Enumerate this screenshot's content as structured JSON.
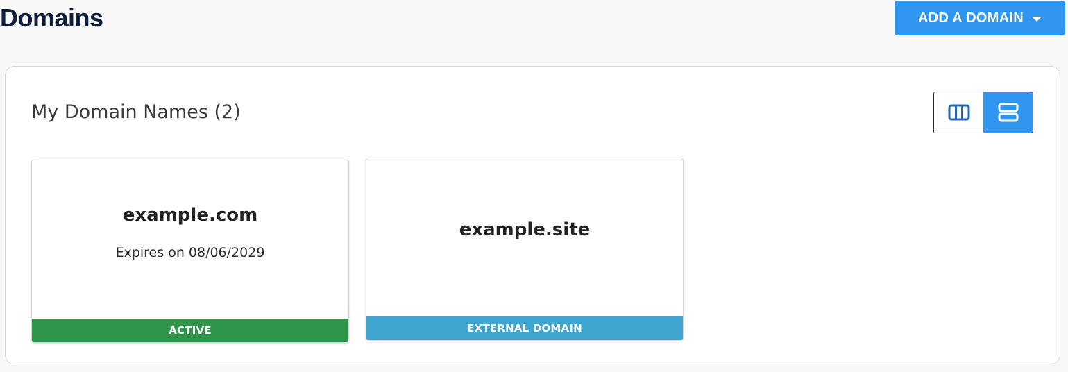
{
  "header": {
    "title": "Domains",
    "add_button_label": "ADD A DOMAIN",
    "add_button_icon": "caret-down-icon"
  },
  "panel": {
    "title": "My Domain Names (2)",
    "view_toggle": {
      "options": [
        {
          "name": "columns-view",
          "icon": "columns-icon",
          "active": false
        },
        {
          "name": "rows-view",
          "icon": "rows-icon",
          "active": true
        }
      ]
    },
    "domains": [
      {
        "name": "example.com",
        "expiry": "Expires on 08/06/2029",
        "status": "ACTIVE",
        "status_color": "#2e954b"
      },
      {
        "name": "example.site",
        "status": "EXTERNAL DOMAIN",
        "status_color": "#3ea6d0"
      }
    ]
  },
  "colors": {
    "accent": "#2f96ef",
    "title": "#0f1f3a",
    "active": "#2e954b",
    "external": "#3ea6d0"
  }
}
